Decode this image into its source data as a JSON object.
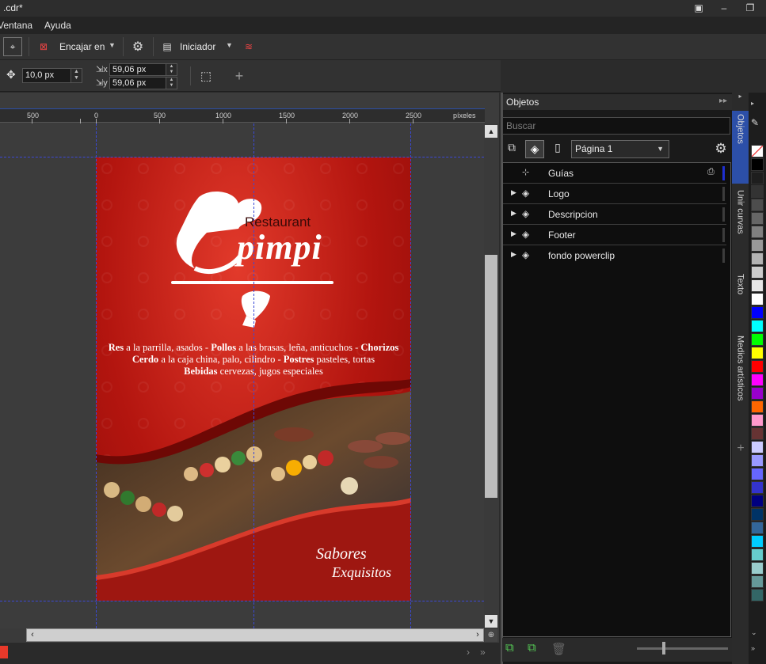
{
  "title_bar": {
    "filename": ".cdr*"
  },
  "menu": {
    "items": [
      "Ventana",
      "Ayuda"
    ]
  },
  "toolbar": {
    "snap_label": "Encajar en",
    "launcher_label": "Iniciador"
  },
  "property_bar": {
    "nudge_value": "10,0 px",
    "dup_x_value": "59,06 px",
    "dup_y_value": "59,06 px"
  },
  "ruler": {
    "ticks": [
      "500",
      "0",
      "500",
      "1000",
      "1500",
      "2000",
      "2500"
    ],
    "unit": "píxeles"
  },
  "poster": {
    "brand_small": "Restaurant",
    "brand_big": "pimpi",
    "line1": [
      {
        "b": "Res",
        "t": " a la parrilla, asados - "
      },
      {
        "b": "Pollos",
        "t": " a las brasas, leña, anticuchos - "
      },
      {
        "b": "Chorizos",
        "t": ""
      }
    ],
    "line2": [
      {
        "b": "Cerdo",
        "t": " a la caja china, palo, cilindro - "
      },
      {
        "b": "Postres",
        "t": " pasteles, tortas"
      }
    ],
    "line3": [
      {
        "b": "Bebidas",
        "t": " cervezas, jugos especiales"
      }
    ],
    "tagline_1": "Sabores",
    "tagline_2": "Exquisitos"
  },
  "objects_panel": {
    "title": "Objetos",
    "search_placeholder": "Buscar",
    "page_select": "Página 1",
    "rows": [
      {
        "label": "Guías",
        "expandable": false
      },
      {
        "label": "Logo",
        "expandable": true
      },
      {
        "label": "Descripcion",
        "expandable": true
      },
      {
        "label": "Footer",
        "expandable": true
      },
      {
        "label": "fondo powerclip",
        "expandable": true
      }
    ]
  },
  "docker_tabs": [
    "Objetos",
    "Unir curvas",
    "Texto",
    "Medios artísticos"
  ],
  "palette": [
    "#ffffff",
    "#000000",
    "#1e1e1e",
    "#333333",
    "#4d4d4d",
    "#666666",
    "#808080",
    "#999999",
    "#b3b3b3",
    "#cccccc",
    "#e6e6e6",
    "#ffffff",
    "#0000ff",
    "#00ffff",
    "#00ff00",
    "#ffff00",
    "#ff0000",
    "#ff00ff",
    "#9900cc",
    "#ff6600",
    "#ff99cc",
    "#663333",
    "#ccccff",
    "#9999ff",
    "#6666ff",
    "#3333cc",
    "#000080",
    "#003366",
    "#336699",
    "#00ccff",
    "#66cccc",
    "#99cccc",
    "#669999",
    "#336666"
  ],
  "colors": {
    "accent": "#2c4fa8",
    "poster_red": "#b3150f"
  }
}
